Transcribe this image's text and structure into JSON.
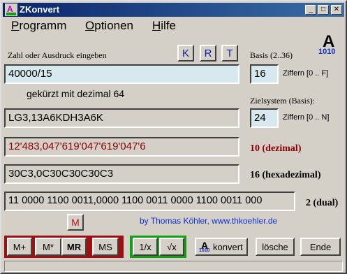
{
  "window": {
    "title": "ZKonvert",
    "minimize": "_",
    "maximize": "□",
    "close": "✕"
  },
  "menu": [
    {
      "label": "Programm",
      "ul": "P",
      "rest": "rogramm"
    },
    {
      "label": "Optionen",
      "ul": "O",
      "rest": "ptionen"
    },
    {
      "label": "Hilfe",
      "ul": "H",
      "rest": "ilfe"
    }
  ],
  "input_label": "Zahl oder Ausdruck eingeben",
  "mode_buttons": {
    "k": "K",
    "r": "R",
    "t": "T"
  },
  "logo": {
    "letter": "A",
    "sub": "1010"
  },
  "source_base": {
    "label": "Basis (2..36)",
    "value": "16",
    "digits": "Ziffern [0 .. F]"
  },
  "expression": "40000/15",
  "note": "gekürzt mit dezimal 64",
  "result_source": "LG3,13A6KDH3A6K",
  "target_base": {
    "label": "Zielsystem (Basis):",
    "value": "24",
    "digits": "Ziffern [0 .. N]"
  },
  "decimal": {
    "value": "12'483,047'619'047'619'047'6",
    "label": "10 (dezimal)",
    "color": "#8b0000"
  },
  "hex": {
    "value": "30C3,0C30C30C30C3",
    "label": "16 (hexadezimal)"
  },
  "binary": {
    "value": "11 0000 1100 0011,0000 1100 0011 0000 1100 0011 000",
    "label": "2 (dual)"
  },
  "memory_indicator": "M",
  "credit": "by Thomas Köhler, www.thkoehler.de",
  "memory_buttons": {
    "mplus": "M+",
    "mtimes": "M*",
    "mr": "MR",
    "ms": "MS"
  },
  "func_buttons": {
    "reciprocal": "1/x",
    "sqrt": "√x"
  },
  "action_buttons": {
    "konvert": "konvert",
    "loesche": "lösche",
    "ende": "Ende"
  },
  "accent_colors": {
    "memory_group": "#a01010",
    "func_group": "#10a010",
    "title_blue": "#0a246a"
  }
}
